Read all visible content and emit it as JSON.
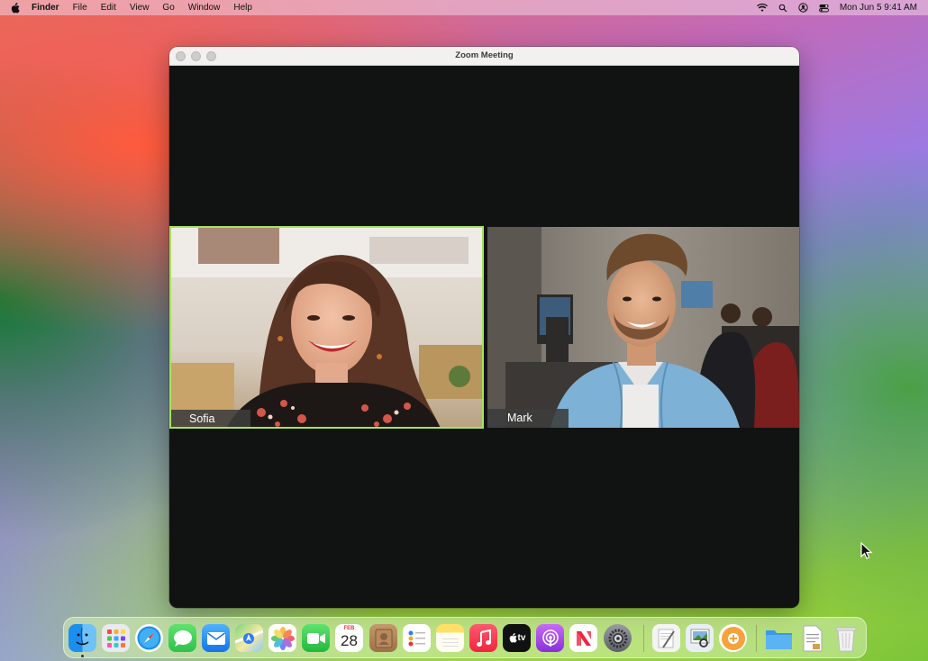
{
  "menubar": {
    "app_name": "Finder",
    "items": [
      "File",
      "Edit",
      "View",
      "Go",
      "Window",
      "Help"
    ],
    "clock": "Mon Jun 5  9:41 AM"
  },
  "window": {
    "title": "Zoom Meeting",
    "participants": [
      {
        "name": "Sofia",
        "active_speaker": true,
        "highlight_color": "#a6e35a"
      },
      {
        "name": "Mark",
        "active_speaker": false
      }
    ]
  },
  "dock": {
    "calendar": {
      "month": "FEB",
      "day": "28"
    },
    "appletv_label": "tv",
    "apps": [
      "finder-icon",
      "launchpad-icon",
      "safari-icon",
      "messages-icon",
      "mail-icon",
      "maps-icon",
      "photos-icon",
      "facetime-icon",
      "calendar-icon",
      "contacts-icon",
      "reminders-icon",
      "notes-icon",
      "music-icon",
      "appletv-icon",
      "podcasts-icon",
      "news-icon",
      "system-settings-icon",
      "textedit-icon",
      "preview-icon",
      "app-icon",
      "folder-icon",
      "document-icon",
      "trash-icon"
    ]
  },
  "colors": {
    "window_bg": "#111312",
    "accent_green": "#a6e35a"
  }
}
